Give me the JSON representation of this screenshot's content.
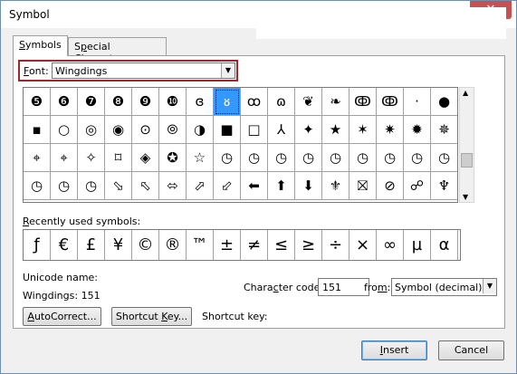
{
  "window": {
    "title": "Symbol",
    "close_glyph": "✕"
  },
  "tabs": [
    {
      "label_prefix": "",
      "label_accel": "S",
      "label_rest": "ymbols"
    },
    {
      "label_prefix": "S",
      "label_accel": "p",
      "label_rest": "ecial Characters"
    }
  ],
  "font": {
    "label_accel": "F",
    "label_rest": "ont:",
    "value": "Wingdings",
    "arrow": "▼"
  },
  "symbol_grid": {
    "selected_index": 7,
    "rows": [
      [
        "❺",
        "❻",
        "❼",
        "❽",
        "❾",
        "❿",
        "ɞ",
        "ᴕ",
        "ꝏ",
        "ɷ",
        "❦",
        "❧",
        "ↂ",
        "ↂ",
        "·",
        "●"
      ],
      [
        "▪",
        "○",
        "◎",
        "◉",
        "⊙",
        "⦾",
        "◑",
        "■",
        "□",
        "⅄",
        "✦",
        "★",
        "✶",
        "✷",
        "✹",
        "✵"
      ],
      [
        "⌖",
        "⌖",
        "✧",
        "⌑",
        "◈",
        "✪",
        "☆",
        "◷",
        "◷",
        "◷",
        "◷",
        "◷",
        "◷",
        "◷",
        "◷",
        "◷"
      ],
      [
        "◷",
        "◷",
        "◷",
        "⬂",
        "⬁",
        "⬄",
        "⬀",
        "⬃",
        "⬅",
        "⬆",
        "⬇",
        "⚜",
        "⛝",
        "⊘",
        "☍",
        "♆"
      ]
    ]
  },
  "scrollbar": {
    "up": "▲",
    "down": "▼"
  },
  "recent": {
    "label_accel": "R",
    "label_rest": "ecently used symbols:",
    "symbols": [
      "ƒ",
      "€",
      "£",
      "¥",
      "©",
      "®",
      "™",
      "±",
      "≠",
      "≤",
      "≥",
      "÷",
      "×",
      "∞",
      "µ",
      "α"
    ]
  },
  "unicode": {
    "name_label": "Unicode name:",
    "value": "Wingdings: 151"
  },
  "char_code": {
    "label_prefix": "Chara",
    "label_accel": "c",
    "label_rest": "ter code:",
    "value": "151"
  },
  "from": {
    "label_prefix": "fro",
    "label_accel": "m",
    "label_rest": ":",
    "value": "Symbol (decimal)",
    "arrow": "▼"
  },
  "buttons": {
    "autocorrect": {
      "accel": "A",
      "rest": "utoCorrect..."
    },
    "shortcut_key": {
      "prefix": "Shortcut ",
      "accel": "K",
      "rest": "ey..."
    },
    "shortcut_label": "Shortcut key:",
    "insert": {
      "accel": "I",
      "rest": "nsert"
    },
    "cancel": "Cancel"
  }
}
